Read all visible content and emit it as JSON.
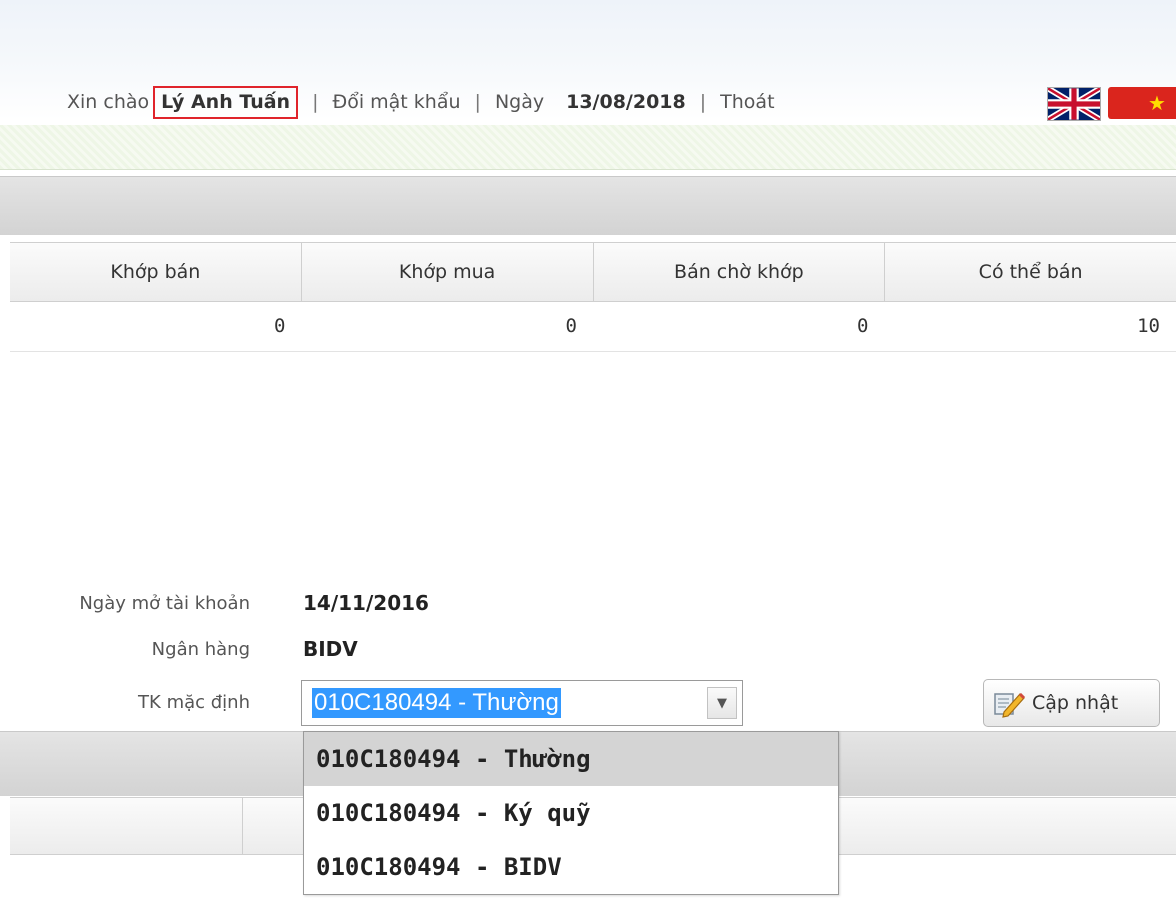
{
  "header": {
    "greeting": "Xin chào",
    "user_name": "Lý Anh Tuấn",
    "separator": "|",
    "change_password": "Đổi mật khẩu",
    "date_label": "Ngày",
    "date_value": "13/08/2018",
    "logout": "Thoát",
    "languages": [
      "english-flag-icon",
      "vietnamese-flag-icon"
    ]
  },
  "stock_table": {
    "columns": [
      "Khớp bán",
      "Khớp mua",
      "Bán chờ khớp",
      "Có thể bán"
    ],
    "rows": [
      [
        "0",
        "0",
        "0",
        "10"
      ]
    ]
  },
  "account_info": {
    "open_date_label": "Ngày mở tài khoản",
    "open_date_value": "14/11/2016",
    "bank_label": "Ngân hàng",
    "bank_value": "BIDV",
    "default_account_label": "TK mặc định",
    "default_account_selected": "010C180494 - Thường",
    "default_account_options": [
      "010C180494 - Thường",
      "010C180494 - Ký quỹ",
      "010C180494 - BIDV"
    ],
    "update_button": "Cập nhật"
  },
  "colors": {
    "highlight_border": "#e0242b",
    "selection": "#3399ff",
    "section_bar": "#d8d8d8"
  }
}
